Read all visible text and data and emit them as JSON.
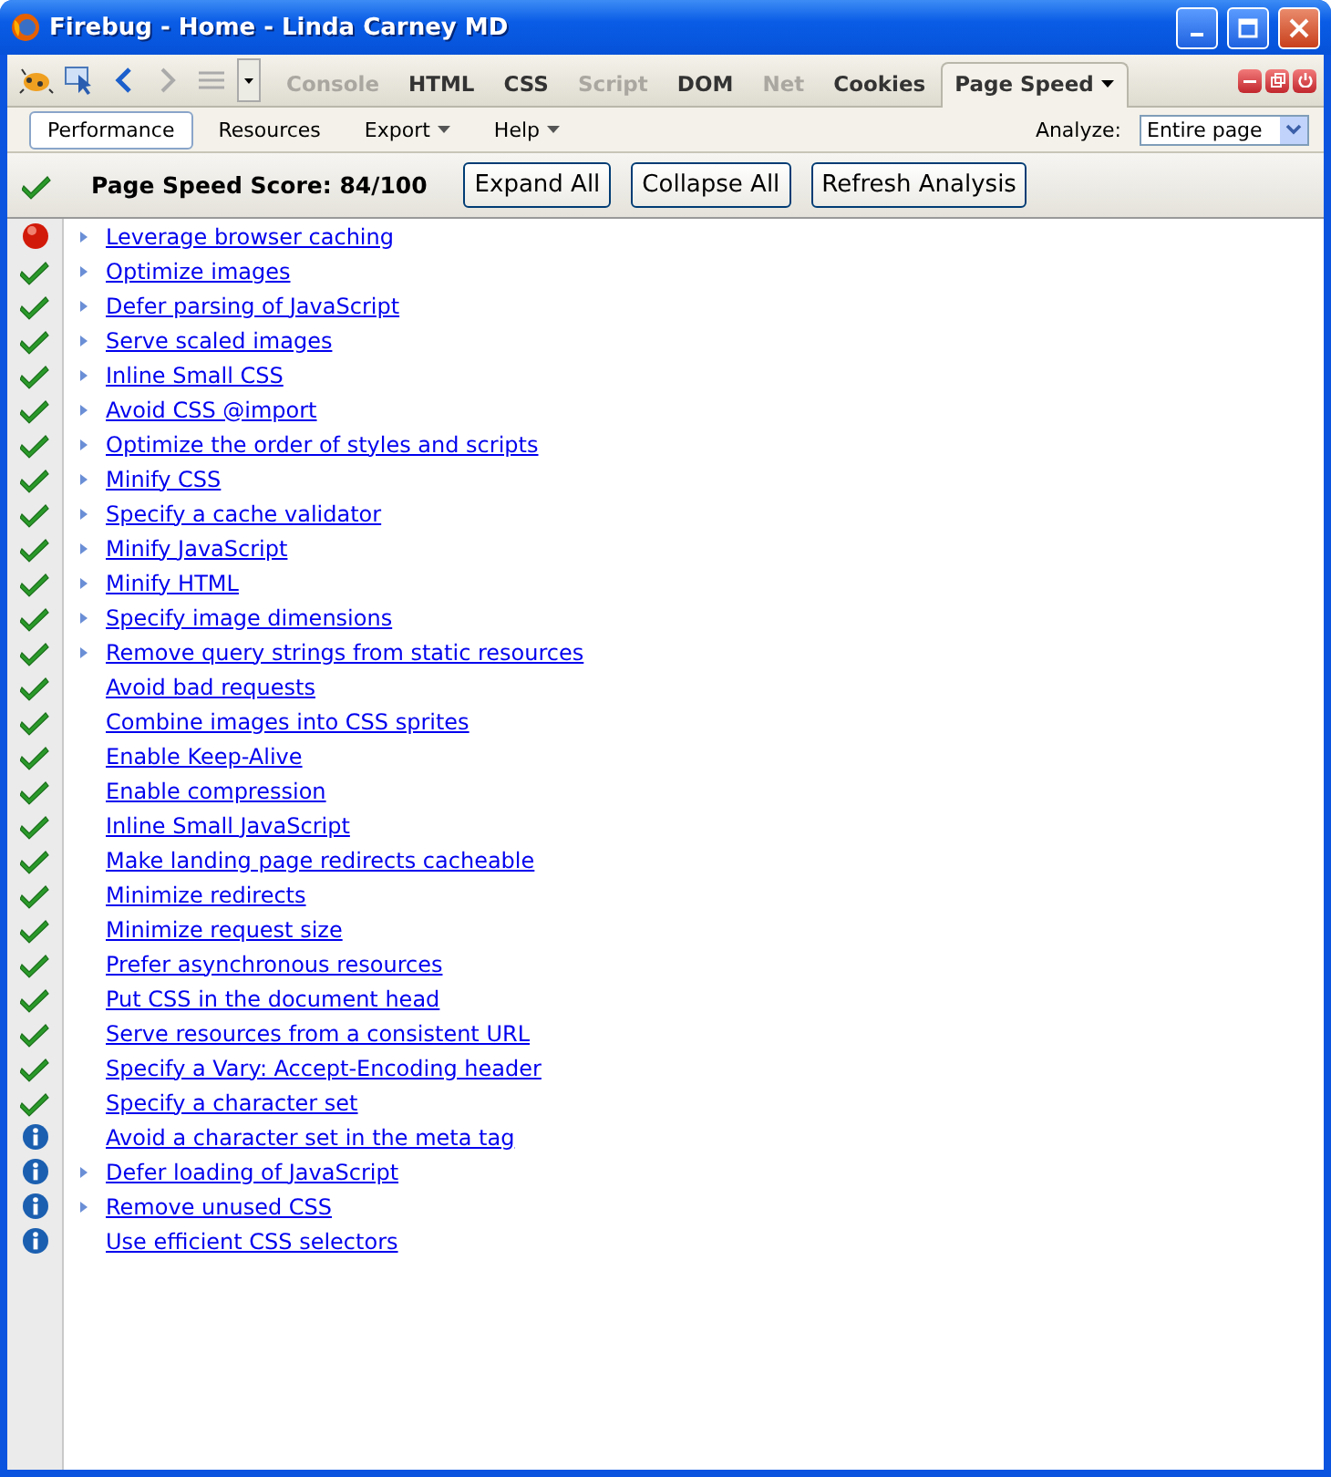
{
  "window": {
    "title": "Firebug - Home - Linda Carney MD"
  },
  "tabs": [
    {
      "label": "Console",
      "selected": false,
      "disabled": true
    },
    {
      "label": "HTML",
      "selected": false,
      "disabled": false
    },
    {
      "label": "CSS",
      "selected": false,
      "disabled": false
    },
    {
      "label": "Script",
      "selected": false,
      "disabled": true
    },
    {
      "label": "DOM",
      "selected": false,
      "disabled": false
    },
    {
      "label": "Net",
      "selected": false,
      "disabled": true
    },
    {
      "label": "Cookies",
      "selected": false,
      "disabled": false
    },
    {
      "label": "Page Speed",
      "selected": true,
      "disabled": false
    }
  ],
  "subtabs": [
    {
      "label": "Performance",
      "selected": true,
      "menu": false
    },
    {
      "label": "Resources",
      "selected": false,
      "menu": false
    },
    {
      "label": "Export",
      "selected": false,
      "menu": true
    },
    {
      "label": "Help",
      "selected": false,
      "menu": true
    }
  ],
  "analyze": {
    "label": "Analyze:",
    "value": "Entire page"
  },
  "score": {
    "kind": "pass",
    "text": "Page Speed Score: 84/100"
  },
  "buttons": [
    "Expand All",
    "Collapse All",
    "Refresh Analysis"
  ],
  "rules": [
    {
      "kind": "fail",
      "expandable": true,
      "label": "Leverage browser caching"
    },
    {
      "kind": "pass",
      "expandable": true,
      "label": "Optimize images"
    },
    {
      "kind": "pass",
      "expandable": true,
      "label": "Defer parsing of JavaScript"
    },
    {
      "kind": "pass",
      "expandable": true,
      "label": "Serve scaled images"
    },
    {
      "kind": "pass",
      "expandable": true,
      "label": "Inline Small CSS"
    },
    {
      "kind": "pass",
      "expandable": true,
      "label": "Avoid CSS @import"
    },
    {
      "kind": "pass",
      "expandable": true,
      "label": "Optimize the order of styles and scripts"
    },
    {
      "kind": "pass",
      "expandable": true,
      "label": "Minify CSS"
    },
    {
      "kind": "pass",
      "expandable": true,
      "label": "Specify a cache validator"
    },
    {
      "kind": "pass",
      "expandable": true,
      "label": "Minify JavaScript"
    },
    {
      "kind": "pass",
      "expandable": true,
      "label": "Minify HTML"
    },
    {
      "kind": "pass",
      "expandable": true,
      "label": "Specify image dimensions"
    },
    {
      "kind": "pass",
      "expandable": true,
      "label": "Remove query strings from static resources"
    },
    {
      "kind": "pass",
      "expandable": false,
      "label": "Avoid bad requests"
    },
    {
      "kind": "pass",
      "expandable": false,
      "label": "Combine images into CSS sprites"
    },
    {
      "kind": "pass",
      "expandable": false,
      "label": "Enable Keep-Alive"
    },
    {
      "kind": "pass",
      "expandable": false,
      "label": "Enable compression"
    },
    {
      "kind": "pass",
      "expandable": false,
      "label": "Inline Small JavaScript"
    },
    {
      "kind": "pass",
      "expandable": false,
      "label": "Make landing page redirects cacheable"
    },
    {
      "kind": "pass",
      "expandable": false,
      "label": "Minimize redirects"
    },
    {
      "kind": "pass",
      "expandable": false,
      "label": "Minimize request size"
    },
    {
      "kind": "pass",
      "expandable": false,
      "label": "Prefer asynchronous resources"
    },
    {
      "kind": "pass",
      "expandable": false,
      "label": "Put CSS in the document head"
    },
    {
      "kind": "pass",
      "expandable": false,
      "label": "Serve resources from a consistent URL"
    },
    {
      "kind": "pass",
      "expandable": false,
      "label": "Specify a Vary: Accept-Encoding header"
    },
    {
      "kind": "pass",
      "expandable": false,
      "label": "Specify a character set"
    },
    {
      "kind": "info",
      "expandable": false,
      "label": "Avoid a character set in the meta tag"
    },
    {
      "kind": "info",
      "expandable": true,
      "label": "Defer loading of JavaScript"
    },
    {
      "kind": "info",
      "expandable": true,
      "label": "Remove unused CSS"
    },
    {
      "kind": "info",
      "expandable": false,
      "label": "Use efficient CSS selectors"
    }
  ]
}
